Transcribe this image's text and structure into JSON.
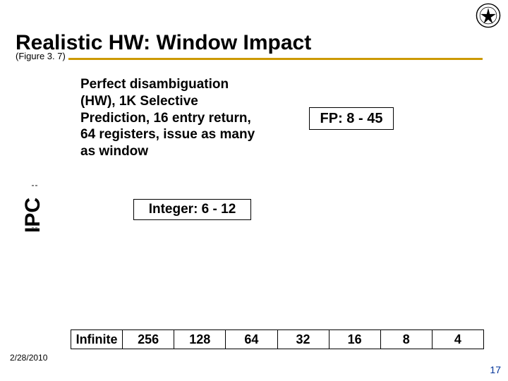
{
  "title": "Realistic HW: Window Impact",
  "figure_ref": "(Figure 3. 7)",
  "description": "Perfect disambiguation (HW), 1K Selective Prediction, 16 entry return, 64 registers, issue as many as window",
  "fp_label": "FP: 8 - 45",
  "integer_label": "Integer: 6 - 12",
  "y_axis_label": "IPC",
  "x_categories": [
    "Infinite",
    "256",
    "128",
    "64",
    "32",
    "16",
    "8",
    "4"
  ],
  "date": "2/28/2010",
  "page_number": "17"
}
